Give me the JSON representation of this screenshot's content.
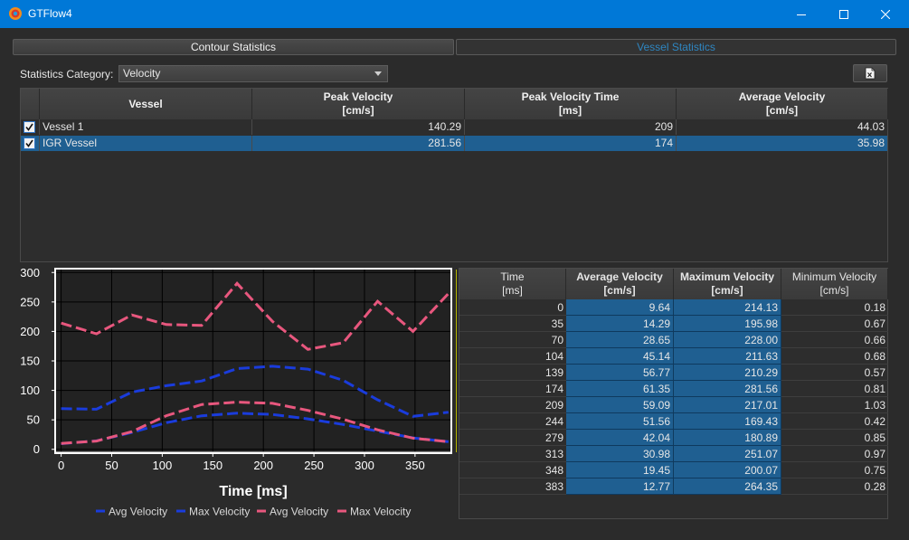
{
  "window": {
    "title": "GTFlow4"
  },
  "tabs": [
    {
      "label": "Contour Statistics",
      "active": true
    },
    {
      "label": "Vessel Statistics",
      "active": false
    }
  ],
  "category": {
    "label": "Statistics Category:",
    "value": "Velocity"
  },
  "vessel_table": {
    "headers": [
      "Vessel",
      "Peak Velocity\n[cm/s]",
      "Peak Velocity Time\n[ms]",
      "Average Velocity\n[cm/s]"
    ],
    "rows": [
      {
        "checked": true,
        "name": "Vessel 1",
        "peak": "140.29",
        "peak_time": "209",
        "avg": "44.03",
        "selected": false
      },
      {
        "checked": true,
        "name": "IGR Vessel",
        "peak": "281.56",
        "peak_time": "174",
        "avg": "35.98",
        "selected": true
      }
    ]
  },
  "chart_data": {
    "type": "line",
    "xlabel": "Time [ms]",
    "ylabel": "",
    "xlim": [
      -5,
      385
    ],
    "ylim": [
      -5,
      305
    ],
    "xticks": [
      0,
      50,
      100,
      150,
      200,
      250,
      300,
      350
    ],
    "yticks": [
      0,
      50,
      100,
      150,
      200,
      250,
      300
    ],
    "grid": true,
    "legend_position": "bottom",
    "current_time_marker": 383,
    "series": [
      {
        "name": "Avg Velocity",
        "color": "#1a3cdc",
        "dashed": true,
        "x": [
          0,
          35,
          70,
          104,
          139,
          174,
          209,
          244,
          279,
          313,
          348,
          383
        ],
        "y": [
          9.64,
          14.29,
          28.65,
          45.14,
          56.77,
          61.35,
          59.09,
          51.56,
          42.04,
          30.98,
          19.45,
          12.77
        ]
      },
      {
        "name": "Max Velocity",
        "color": "#1a3cdc",
        "dashed": true,
        "x": [
          0,
          35,
          70,
          104,
          139,
          174,
          209,
          244,
          279,
          313,
          348,
          383
        ],
        "y": [
          69,
          68,
          97,
          108,
          116,
          137,
          141,
          136,
          117,
          84,
          56,
          63
        ]
      },
      {
        "name": "Avg Velocity",
        "color": "#e8577e",
        "dashed": true,
        "x": [
          0,
          35,
          70,
          104,
          139,
          174,
          209,
          244,
          279,
          313,
          348,
          383
        ],
        "y": [
          10,
          14,
          30,
          57,
          76,
          80,
          78,
          66,
          51,
          33,
          19,
          13
        ]
      },
      {
        "name": "Max Velocity",
        "color": "#e8577e",
        "dashed": true,
        "x": [
          0,
          35,
          70,
          104,
          139,
          174,
          209,
          244,
          279,
          313,
          348,
          383
        ],
        "y": [
          214.13,
          195.98,
          228.0,
          211.63,
          210.29,
          281.56,
          217.01,
          169.43,
          180.89,
          251.07,
          200.07,
          264.35
        ]
      }
    ]
  },
  "data_table": {
    "headers": [
      "Time\n[ms]",
      "Average Velocity\n[cm/s]",
      "Maximum Velocity\n[cm/s]",
      "Minimum Velocity\n[cm/s]"
    ],
    "rows": [
      [
        "0",
        "9.64",
        "214.13",
        "0.18"
      ],
      [
        "35",
        "14.29",
        "195.98",
        "0.67"
      ],
      [
        "70",
        "28.65",
        "228.00",
        "0.66"
      ],
      [
        "104",
        "45.14",
        "211.63",
        "0.68"
      ],
      [
        "139",
        "56.77",
        "210.29",
        "0.57"
      ],
      [
        "174",
        "61.35",
        "281.56",
        "0.81"
      ],
      [
        "209",
        "59.09",
        "217.01",
        "1.03"
      ],
      [
        "244",
        "51.56",
        "169.43",
        "0.42"
      ],
      [
        "279",
        "42.04",
        "180.89",
        "0.85"
      ],
      [
        "313",
        "30.98",
        "251.07",
        "0.97"
      ],
      [
        "348",
        "19.45",
        "200.07",
        "0.75"
      ],
      [
        "383",
        "12.77",
        "264.35",
        "0.28"
      ]
    ]
  }
}
